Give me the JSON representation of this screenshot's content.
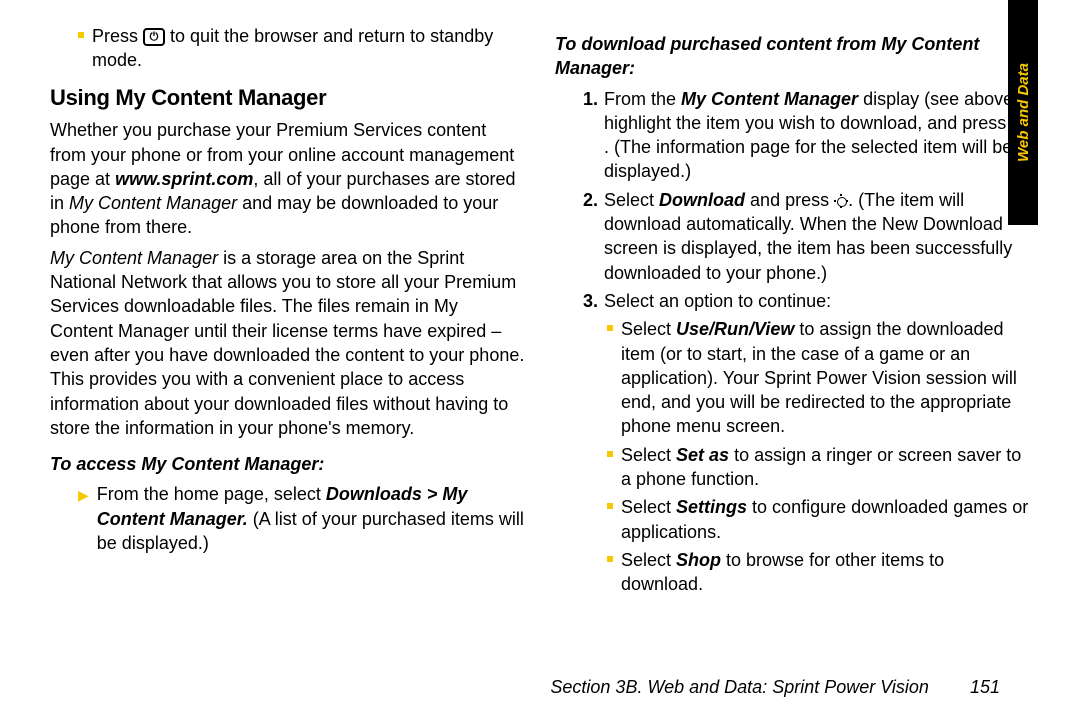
{
  "sideTab": "Web and Data",
  "footer": {
    "section": "Section 3B. Web and Data: Sprint Power Vision",
    "page": "151"
  },
  "left": {
    "bullet1_a": "Press ",
    "bullet1_b": " to quit the browser and return to standby mode.",
    "heading": "Using My Content Manager",
    "p1_a": "Whether you purchase your Premium Services content from your phone or from your online account management page at ",
    "p1_b": "www.sprint.com",
    "p1_c": ", all of your purchases are stored in ",
    "p1_d": "My Content Manager",
    "p1_e": " and may be downloaded to your phone from there.",
    "p2_a": "My Content Manager",
    "p2_b": " is a storage area on the Sprint National Network that allows you to store all your Premium Services downloadable files. The files remain in My Content Manager until their license terms have expired – even after you have downloaded the content to your phone. This provides you with a convenient place to access information about your downloaded files without having to store the information in your phone's memory.",
    "sub1": "To access My Content Manager:",
    "arrow_a": "From the home page, select ",
    "arrow_b": "Downloads > My Content Manager.",
    "arrow_c": " (A list of your purchased items will be displayed.)"
  },
  "right": {
    "sub1": "To download purchased content from My Content Manager:",
    "s1_a": "From the ",
    "s1_b": "My Content Manager",
    "s1_c": " display (see above), highlight the item you wish to download, and press ",
    "s1_d": ". (The information page for the selected item will be displayed.)",
    "s2_a": "Select ",
    "s2_b": "Download",
    "s2_c": " and press ",
    "s2_d": ". (The item will download automatically. When the New Download screen is displayed, the item has been successfully downloaded to your phone.)",
    "s3": "Select an option to continue:",
    "b1_a": "Select ",
    "b1_b": "Use/Run/View",
    "b1_c": " to assign the downloaded item (or to start, in the case of a game or an application). Your Sprint Power Vision session will end, and you will be redirected to the appropriate phone menu screen.",
    "b2_a": "Select ",
    "b2_b": "Set as",
    "b2_c": " to assign a ringer or screen saver to a phone function.",
    "b3_a": "Select ",
    "b3_b": "Settings",
    "b3_c": " to configure downloaded games or applications.",
    "b4_a": "Select ",
    "b4_b": "Shop",
    "b4_c": " to browse for other items to download."
  }
}
